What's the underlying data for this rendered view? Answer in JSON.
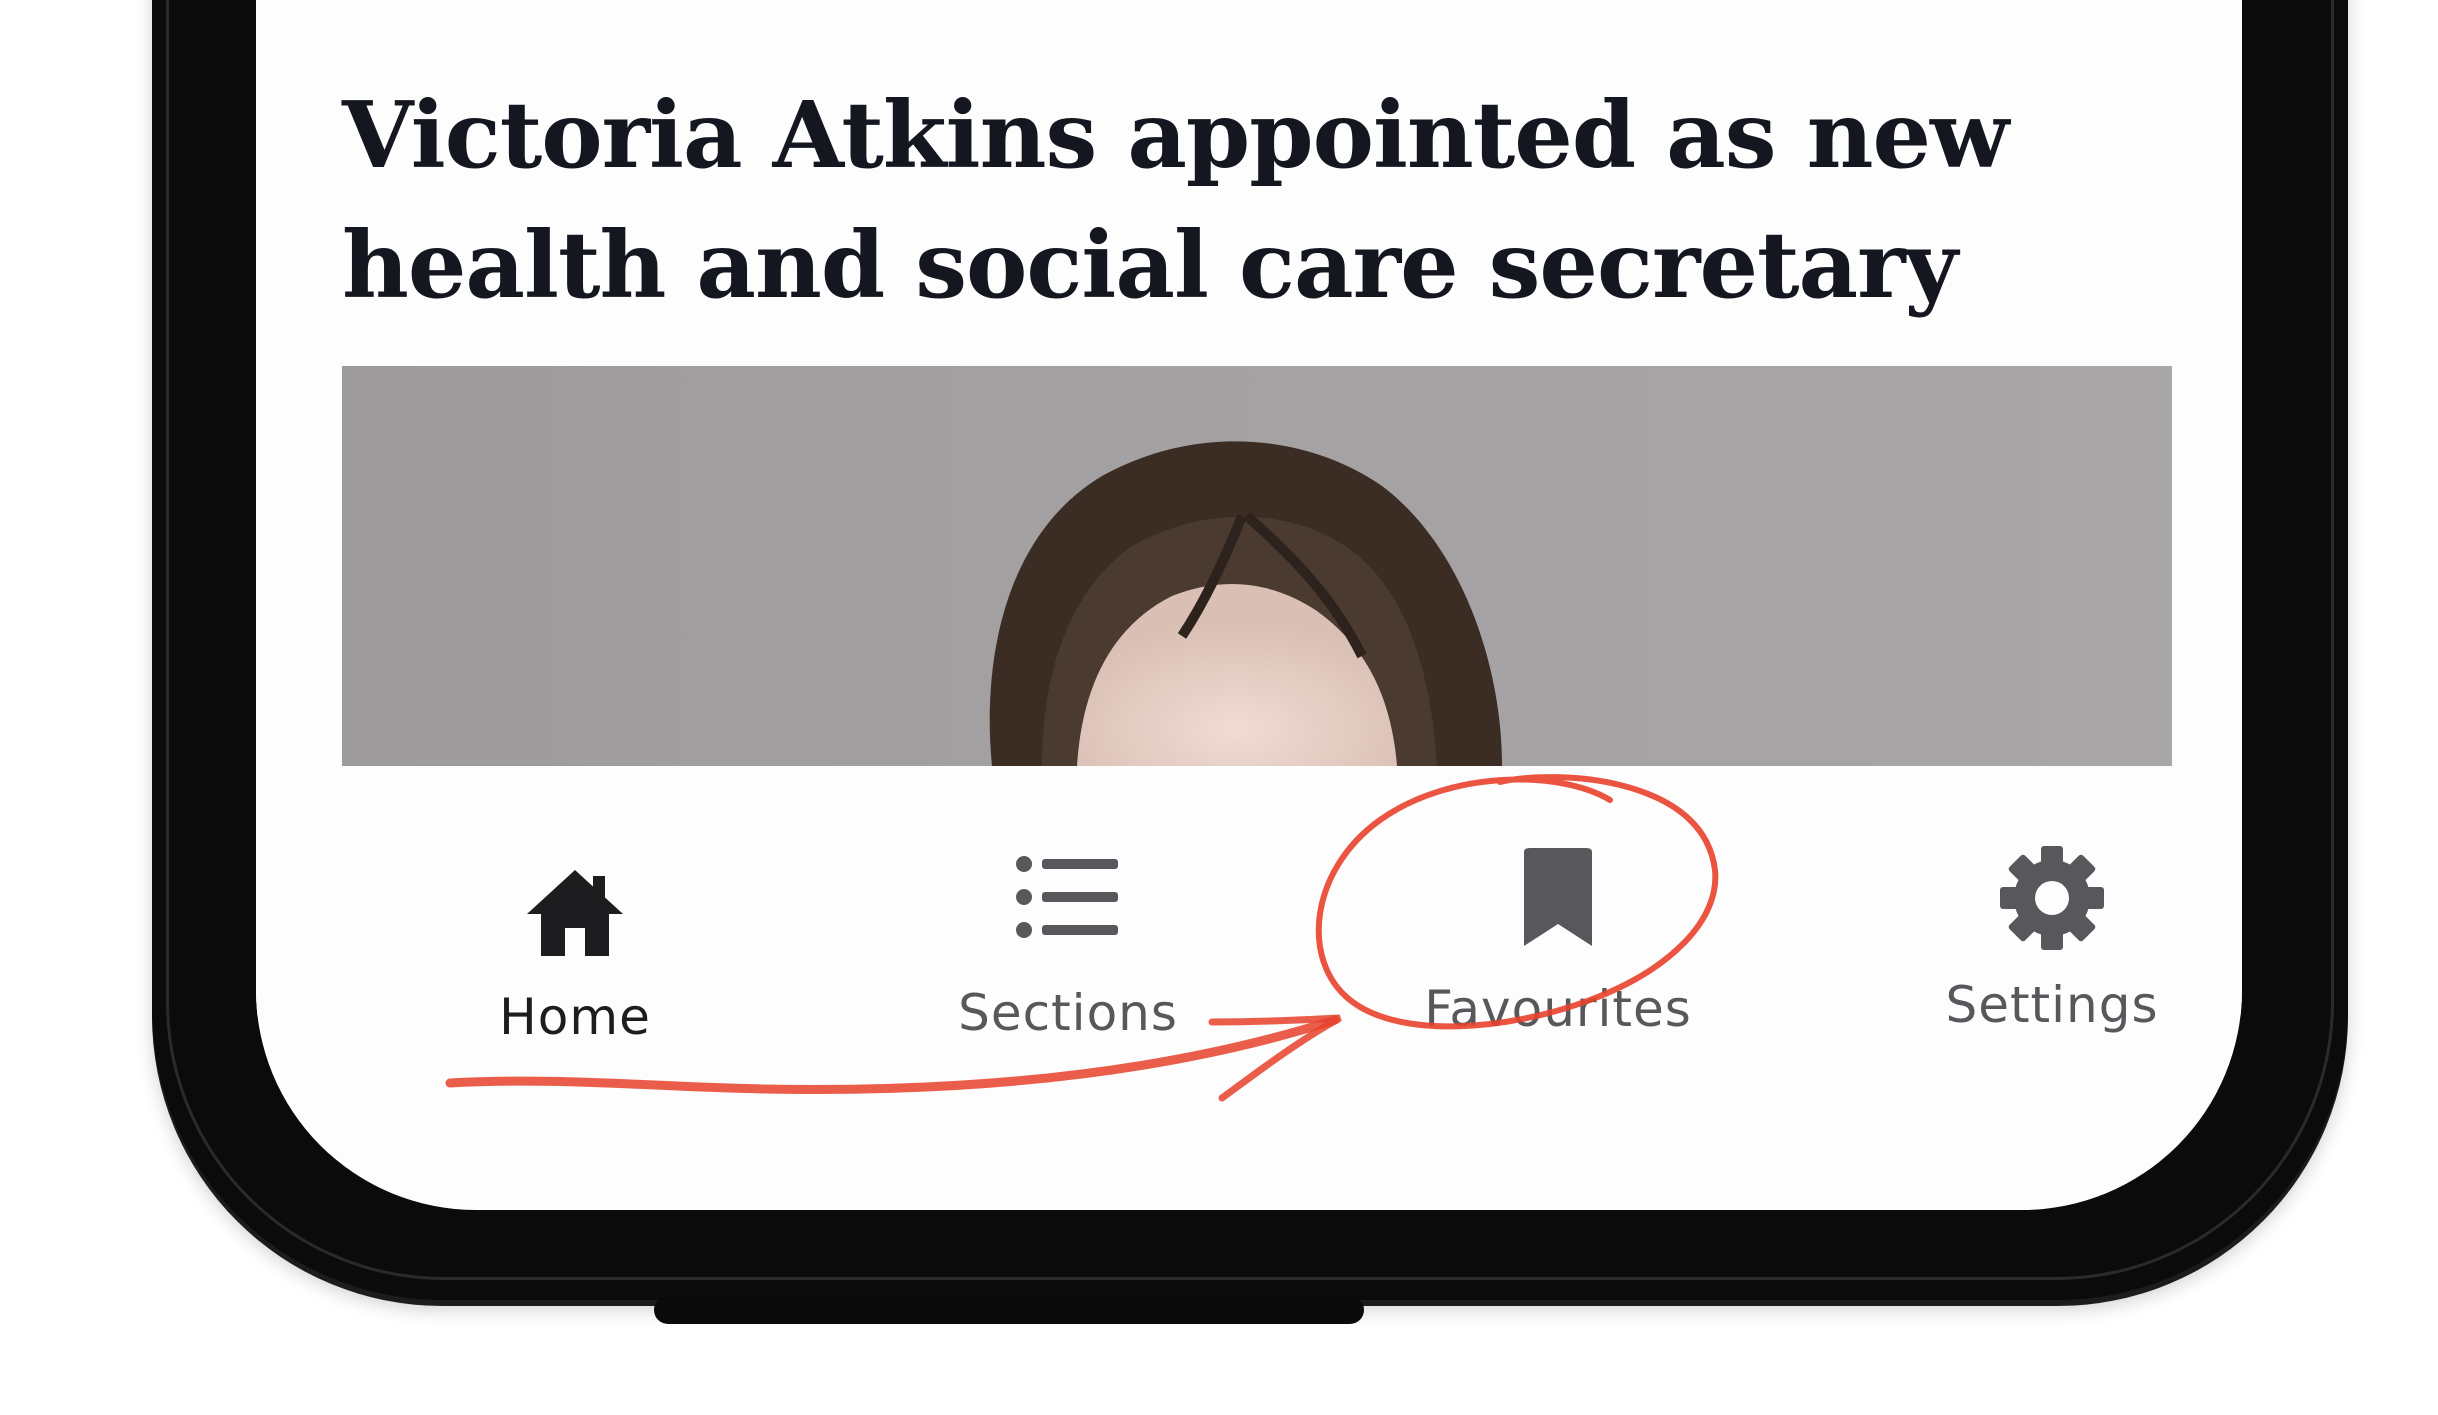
{
  "article": {
    "headline": "Victoria Atkins appointed as new health and social care secretary"
  },
  "tab_bar": {
    "active_tab": "Home",
    "items": [
      {
        "label": "Home",
        "icon": "home-icon"
      },
      {
        "label": "Sections",
        "icon": "list-icon"
      },
      {
        "label": "Favourites",
        "icon": "bookmark-icon"
      },
      {
        "label": "Settings",
        "icon": "gear-icon"
      }
    ]
  },
  "colors": {
    "annotation": "#e8412c",
    "active_tab": "#1d1d1f",
    "inactive_tab": "#58585c",
    "phone_frame": "#0b0b0c"
  }
}
